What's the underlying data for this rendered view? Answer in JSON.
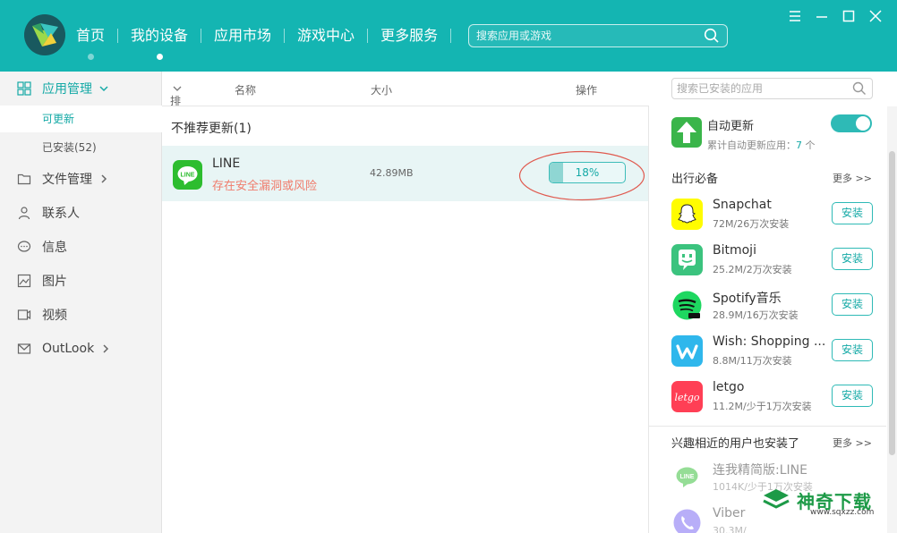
{
  "header": {
    "nav": [
      {
        "label": "首页",
        "active": false
      },
      {
        "label": "我的设备",
        "active": true
      },
      {
        "label": "应用市场",
        "active": false
      },
      {
        "label": "游戏中心",
        "active": false
      },
      {
        "label": "更多服务",
        "active": false
      }
    ],
    "search_placeholder": "搜索应用或游戏"
  },
  "sidebar": {
    "app_manage": "应用管理",
    "sub_updatable": "可更新",
    "sub_installed": "已安装(52)",
    "file_manage": "文件管理",
    "contacts": "联系人",
    "messages": "信息",
    "pictures": "图片",
    "videos": "视频",
    "outlook": "OutLook"
  },
  "columns": {
    "sort": "排序",
    "name": "名称",
    "size": "大小",
    "action": "操作",
    "search_placeholder": "搜索已安装的应用"
  },
  "main": {
    "group_title": "不推荐更新(1)",
    "app": {
      "name": "LINE",
      "warning": "存在安全漏洞或风险",
      "size": "42.89MB",
      "progress_text": "18%",
      "progress": 0.18
    }
  },
  "right": {
    "auto_update": {
      "title": "自动更新",
      "sub_prefix": "累计自动更新应用：",
      "count": "7",
      "sub_suffix": " 个",
      "enabled": true
    },
    "travel": {
      "title": "出行必备",
      "more": "更多 >>",
      "apps": [
        {
          "name": "Snapchat",
          "meta": "72M/26万次安装",
          "button": "安装",
          "icon": "snapchat-icon"
        },
        {
          "name": "Bitmoji",
          "meta": "25.2M/2万次安装",
          "button": "安装",
          "icon": "bitmoji-icon"
        },
        {
          "name": "Spotify音乐",
          "meta": "28.9M/16万次安装",
          "button": "安装",
          "icon": "spotify-icon"
        },
        {
          "name": "Wish: Shopping ...",
          "meta": "8.8M/11万次安装",
          "button": "安装",
          "icon": "wish-icon"
        },
        {
          "name": "letgo",
          "meta": "11.2M/少于1万次安装",
          "button": "安装",
          "icon": "letgo-icon"
        }
      ]
    },
    "similar": {
      "title": "兴趣相近的用户也安装了",
      "more": "更多 >>",
      "apps": [
        {
          "name": "连我精简版:LINE",
          "meta": "1014K/少于1万次安装"
        },
        {
          "name": "Viber",
          "meta": "30.3M/"
        }
      ]
    }
  },
  "watermark": {
    "text": "神奇下载",
    "url": "www.sqxzz.com"
  },
  "colors": {
    "accent": "#14b5b2",
    "warning": "#f07c6c"
  }
}
